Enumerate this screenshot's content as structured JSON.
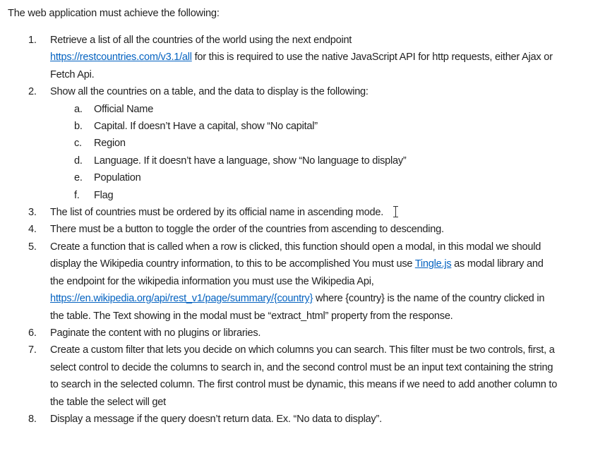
{
  "intro": "The web application must achieve the following:",
  "items": {
    "n1": "1.",
    "t1a": "Retrieve a list of all the countries of the world using the next endpoint",
    "l1": "https://restcountries.com/v3.1/all",
    "t1b": " for this is required to use the native JavaScript API for http requests, either Ajax or Fetch Api.",
    "n2": "2.",
    "t2": "Show all the countries on a table, and the data to display is the following:",
    "sub": [
      {
        "letter": "a.",
        "text": "Official Name"
      },
      {
        "letter": "b.",
        "text": "Capital. If doesn’t Have a capital, show “No capital”"
      },
      {
        "letter": "c.",
        "text": "Region"
      },
      {
        "letter": "d.",
        "text": "Language. If it doesn’t have a language, show “No language to display”"
      },
      {
        "letter": "e.",
        "text": "Population"
      },
      {
        "letter": "f.",
        "text": "Flag"
      }
    ],
    "n3": "3.",
    "t3": "The list of countries must be ordered by its official name in ascending mode.",
    "n4": "4.",
    "t4": "There must be a button to toggle the order of the countries from ascending to descending.",
    "n5": "5.",
    "t5a": "Create a function that is called when a row is clicked, this function should open a modal, in this modal we should display the Wikipedia country information, to this to be accomplished You must use ",
    "l5a": "Tingle.js",
    "t5b": " as modal library and the endpoint for the wikipedia information you must use the Wikipedia Api, ",
    "l5b": "https://en.wikipedia.org/api/rest_v1/page/summary/{country}",
    "t5c": " where {country} is the name of the country clicked in the table. The Text showing in the modal must be “extract_html” property from the response.",
    "n6": "6.",
    "t6": "Paginate the content with no plugins or libraries.",
    "n7": "7.",
    "t7": "Create a custom filter that lets you decide on which columns you can search. This filter must be two controls, first, a select control to decide the columns to search in, and the second control must be an input text containing the string to search in the selected column. The first control must be dynamic, this means if we need to add another column to the table the select will get",
    "n8": "8.",
    "t8": "Display a message if the query doesn’t return data. Ex. “No data to display”."
  }
}
